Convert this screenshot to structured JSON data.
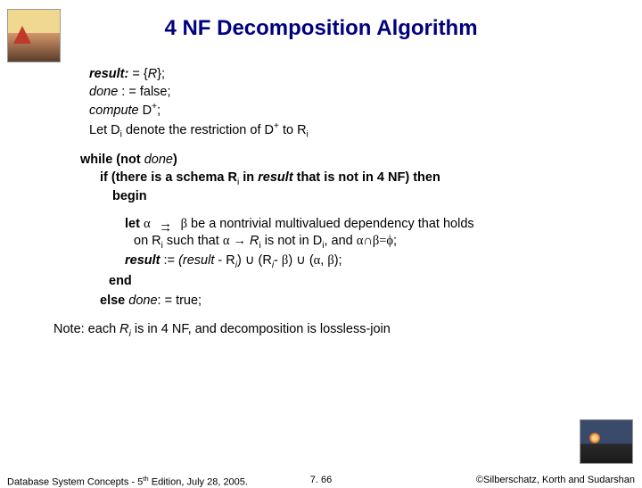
{
  "title": "4 NF Decomposition Algorithm",
  "algo": {
    "l1a": "result: ",
    "l1b": "= {",
    "l1c": "R",
    "l1d": "};",
    "l2a": "done ",
    "l2b": ": = false;",
    "l3a": "compute ",
    "l3b": "D",
    "l3c": ";",
    "l4a": "Let D",
    "l4b": " denote the restriction of D",
    "l4c": " to R",
    "while": "while ",
    "notdone": "(not ",
    "done2": "done",
    "paren": ")",
    "if": "if ",
    "if_body_a": "(there is a schema ",
    "if_body_b": "R",
    "if_body_c": " in ",
    "if_body_d": "result",
    "if_body_e": " that is not in 4 NF) ",
    "then": "then",
    "begin": "begin",
    "let": "let ",
    "let_a": " be a nontrivial multivalued dependency that holds",
    "on": " on ",
    "on_b": "R",
    "on_c": " such that ",
    "on_d": " R",
    "on_e": " is not in D",
    "on_f": ", and ",
    "on_g": ";",
    "res": "result",
    "res_b": " := ",
    "res_c": " (result ",
    "res_d": "- R",
    "res_e": ") ",
    "res_f": " (R",
    "res_g": "- ",
    "res_h": ") ",
    "res_i": " (",
    "res_j": ", ",
    "res_k": ");",
    "end": "end",
    "else": "else ",
    "done3": "done",
    "done3b": ": = true;",
    "note_a": "Note: each ",
    "note_b": "R",
    "note_c": " is in 4 NF, and decomposition is lossless-join"
  },
  "sym": {
    "plus": "+",
    "i": "i",
    "alpha": "α",
    "beta": "β",
    "arrow": "→",
    "cap": "∩",
    "cup": "∪",
    "eq": "=",
    "phi": "ϕ"
  },
  "footer": {
    "left_a": "Database System Concepts - 5",
    "left_b": " Edition, July 28, 2005.",
    "th": "th",
    "center": "7. 66",
    "right": "©Silberschatz, Korth and Sudarshan"
  }
}
